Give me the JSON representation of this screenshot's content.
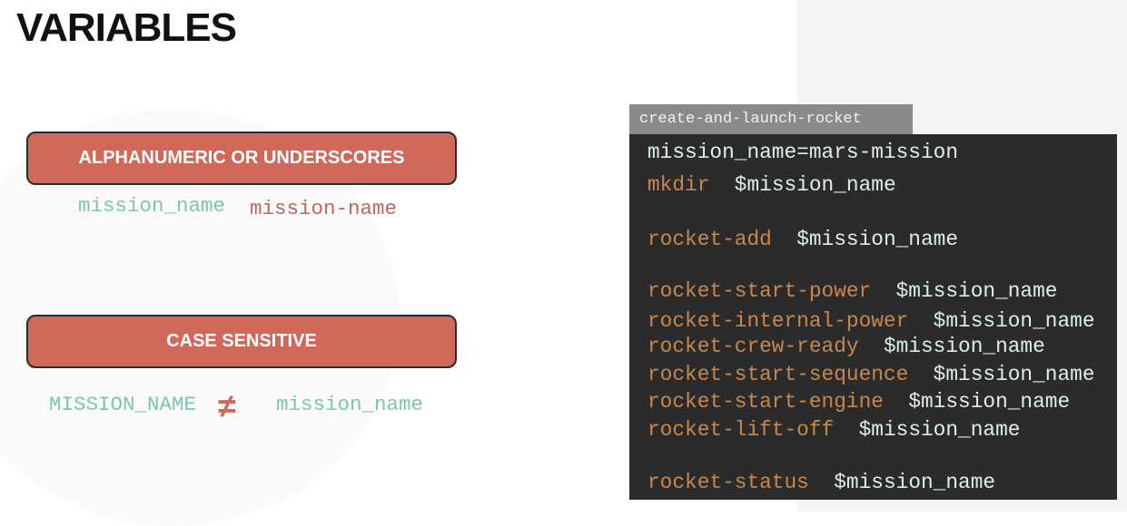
{
  "title": "VARIABLES",
  "rules": [
    {
      "label": "ALPHANUMERIC OR UNDERSCORES",
      "valid_example": "mission_name",
      "invalid_example": "mission-name"
    },
    {
      "label": "CASE SENSITIVE",
      "left_example": "MISSION_NAME",
      "operator": "≠",
      "right_example": "mission_name"
    }
  ],
  "script": {
    "filename": "create-and-launch-rocket",
    "lines": [
      {
        "cmd": "",
        "arg": "mission_name=mars-mission"
      },
      {
        "cmd": "mkdir",
        "arg": "$mission_name"
      },
      {
        "cmd": "rocket-add",
        "arg": "$mission_name"
      },
      {
        "cmd": "rocket-start-power",
        "arg": "$mission_name"
      },
      {
        "cmd": "rocket-internal-power",
        "arg": "$mission_name"
      },
      {
        "cmd": "rocket-crew-ready",
        "arg": "$mission_name"
      },
      {
        "cmd": "rocket-start-sequence",
        "arg": "$mission_name"
      },
      {
        "cmd": "rocket-start-engine",
        "arg": "$mission_name"
      },
      {
        "cmd": "rocket-lift-off",
        "arg": "$mission_name"
      },
      {
        "cmd": "rocket-status",
        "arg": "$mission_name"
      }
    ]
  },
  "colors": {
    "accent": "#d0695a",
    "valid": "#7cc5b5",
    "invalid": "#c0665a",
    "command": "#c8874f"
  }
}
